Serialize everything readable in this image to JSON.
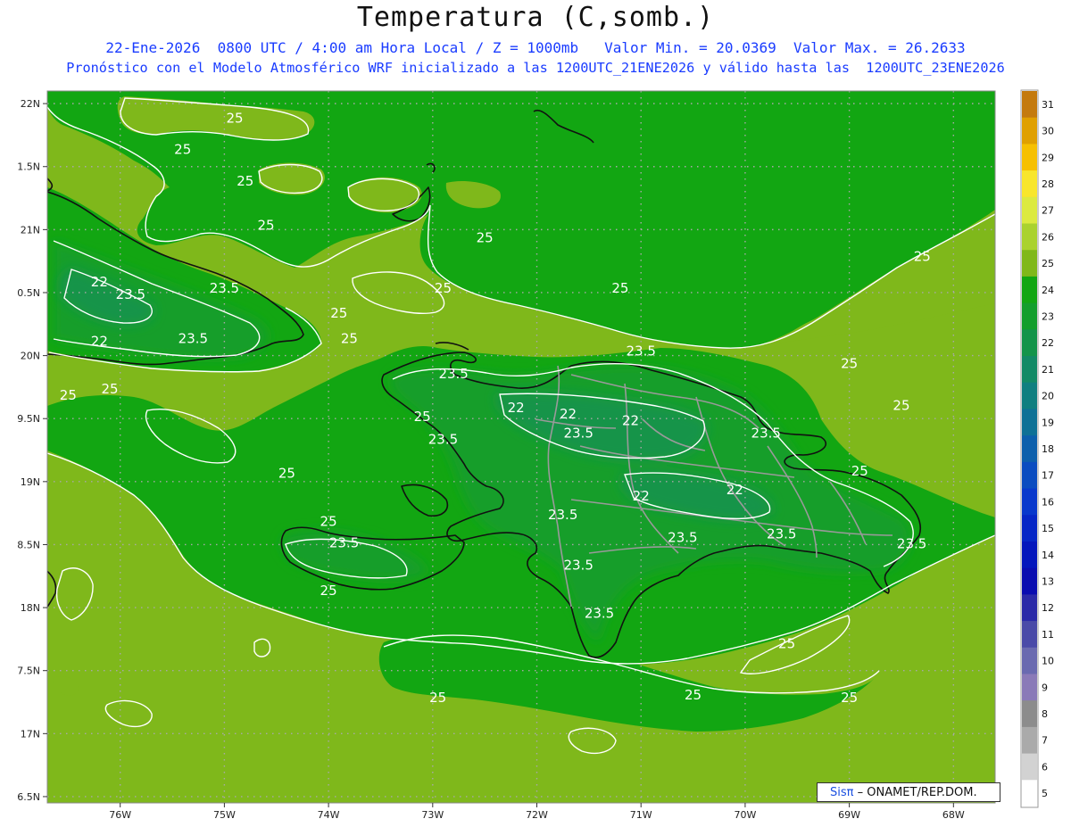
{
  "header": {
    "title": "Temperatura (C,somb.)",
    "line1": "22-Ene-2026  0800 UTC / 4:00 am Hora Local / Z = 1000mb   Valor Min. = 20.0369  Valor Max. = 26.2633",
    "line2": "Pronóstico con el Modelo Atmosférico WRF inicializado a las 1200UTC_21ENE2026 y válido hasta las  1200UTC_23ENE2026"
  },
  "map": {
    "lon_range": [
      -76.7,
      -67.6
    ],
    "lat_range": [
      16.45,
      22.1
    ],
    "lat_ticks": [
      {
        "v": 22,
        "label": "22N"
      },
      {
        "v": 21.5,
        "label": "1.5N"
      },
      {
        "v": 21,
        "label": "21N"
      },
      {
        "v": 20.5,
        "label": "0.5N"
      },
      {
        "v": 20,
        "label": "20N"
      },
      {
        "v": 19.5,
        "label": "9.5N"
      },
      {
        "v": 19,
        "label": "19N"
      },
      {
        "v": 18.5,
        "label": "8.5N"
      },
      {
        "v": 18,
        "label": "18N"
      },
      {
        "v": 17.5,
        "label": "7.5N"
      },
      {
        "v": 17,
        "label": "17N"
      },
      {
        "v": 16.5,
        "label": "6.5N"
      }
    ],
    "lon_ticks": [
      {
        "v": -76,
        "label": "76W"
      },
      {
        "v": -75,
        "label": "75W"
      },
      {
        "v": -74,
        "label": "74W"
      },
      {
        "v": -73,
        "label": "73W"
      },
      {
        "v": -72,
        "label": "72W"
      },
      {
        "v": -71,
        "label": "71W"
      },
      {
        "v": -70,
        "label": "70W"
      },
      {
        "v": -69,
        "label": "69W"
      },
      {
        "v": -68,
        "label": "68W"
      }
    ],
    "contour_labels": [
      {
        "lon": -74.9,
        "lat": 21.85,
        "text": "25"
      },
      {
        "lon": -75.4,
        "lat": 21.6,
        "text": "25"
      },
      {
        "lon": -74.8,
        "lat": 21.35,
        "text": "25"
      },
      {
        "lon": -74.6,
        "lat": 21.0,
        "text": "25"
      },
      {
        "lon": -72.5,
        "lat": 20.9,
        "text": "25"
      },
      {
        "lon": -72.9,
        "lat": 20.5,
        "text": "25"
      },
      {
        "lon": -71.2,
        "lat": 20.5,
        "text": "25"
      },
      {
        "lon": -68.3,
        "lat": 20.75,
        "text": "25"
      },
      {
        "lon": -76.2,
        "lat": 20.55,
        "text": "22"
      },
      {
        "lon": -75.9,
        "lat": 20.45,
        "text": "23.5"
      },
      {
        "lon": -75.0,
        "lat": 20.5,
        "text": "23.5"
      },
      {
        "lon": -73.9,
        "lat": 20.3,
        "text": "25"
      },
      {
        "lon": -76.2,
        "lat": 20.08,
        "text": "22"
      },
      {
        "lon": -75.3,
        "lat": 20.1,
        "text": "23.5"
      },
      {
        "lon": -73.8,
        "lat": 20.1,
        "text": "25"
      },
      {
        "lon": -71.0,
        "lat": 20.0,
        "text": "23.5"
      },
      {
        "lon": -69.0,
        "lat": 19.9,
        "text": "25"
      },
      {
        "lon": -72.8,
        "lat": 19.82,
        "text": "23.5"
      },
      {
        "lon": -72.2,
        "lat": 19.55,
        "text": "22"
      },
      {
        "lon": -71.7,
        "lat": 19.5,
        "text": "22"
      },
      {
        "lon": -71.1,
        "lat": 19.45,
        "text": "22"
      },
      {
        "lon": -73.1,
        "lat": 19.48,
        "text": "25"
      },
      {
        "lon": -68.5,
        "lat": 19.57,
        "text": "25"
      },
      {
        "lon": -76.5,
        "lat": 19.65,
        "text": "25"
      },
      {
        "lon": -76.1,
        "lat": 19.7,
        "text": "25"
      },
      {
        "lon": -71.6,
        "lat": 19.35,
        "text": "23.5"
      },
      {
        "lon": -72.9,
        "lat": 19.3,
        "text": "23.5"
      },
      {
        "lon": -69.8,
        "lat": 19.35,
        "text": "23.5"
      },
      {
        "lon": -68.9,
        "lat": 19.05,
        "text": "25"
      },
      {
        "lon": -74.4,
        "lat": 19.03,
        "text": "25"
      },
      {
        "lon": -71.0,
        "lat": 18.85,
        "text": "22"
      },
      {
        "lon": -70.1,
        "lat": 18.9,
        "text": "22"
      },
      {
        "lon": -71.75,
        "lat": 18.7,
        "text": "23.5"
      },
      {
        "lon": -74.0,
        "lat": 18.65,
        "text": "25"
      },
      {
        "lon": -73.85,
        "lat": 18.48,
        "text": "23.5"
      },
      {
        "lon": -70.6,
        "lat": 18.52,
        "text": "23.5"
      },
      {
        "lon": -69.65,
        "lat": 18.55,
        "text": "23.5"
      },
      {
        "lon": -68.4,
        "lat": 18.47,
        "text": "23.5"
      },
      {
        "lon": -71.6,
        "lat": 18.3,
        "text": "23.5"
      },
      {
        "lon": -74.0,
        "lat": 18.1,
        "text": "25"
      },
      {
        "lon": -71.4,
        "lat": 17.92,
        "text": "23.5"
      },
      {
        "lon": -69.6,
        "lat": 17.68,
        "text": "25"
      },
      {
        "lon": -72.95,
        "lat": 17.25,
        "text": "25"
      },
      {
        "lon": -70.5,
        "lat": 17.27,
        "text": "25"
      },
      {
        "lon": -69.0,
        "lat": 17.25,
        "text": "25"
      }
    ]
  },
  "colorbar": {
    "levels": [
      31,
      30,
      29,
      28,
      27,
      26,
      25,
      24,
      23,
      22,
      21,
      20,
      19,
      18,
      17,
      16,
      15,
      14,
      13,
      12,
      11,
      10,
      9,
      8,
      7,
      6,
      5
    ],
    "colors": [
      "#c47a0e",
      "#e0a000",
      "#f6c000",
      "#f8e62c",
      "#dcea40",
      "#aad22e",
      "#80b81a",
      "#12a612",
      "#139e2c",
      "#13944a",
      "#128a66",
      "#0f7f80",
      "#0e7196",
      "#0c5fac",
      "#0a4cc0",
      "#0838cc",
      "#0626c6",
      "#0416bc",
      "#0a0cb0",
      "#2b2aa8",
      "#4a4aa8",
      "#6a6ab0",
      "#8a7ab8",
      "#8c8c8c",
      "#aaaaaa",
      "#d2d2d2",
      "#ffffff"
    ]
  },
  "credit": {
    "sis": "Sisπ",
    "rest": "– ONAMET/REP.DOM."
  }
}
